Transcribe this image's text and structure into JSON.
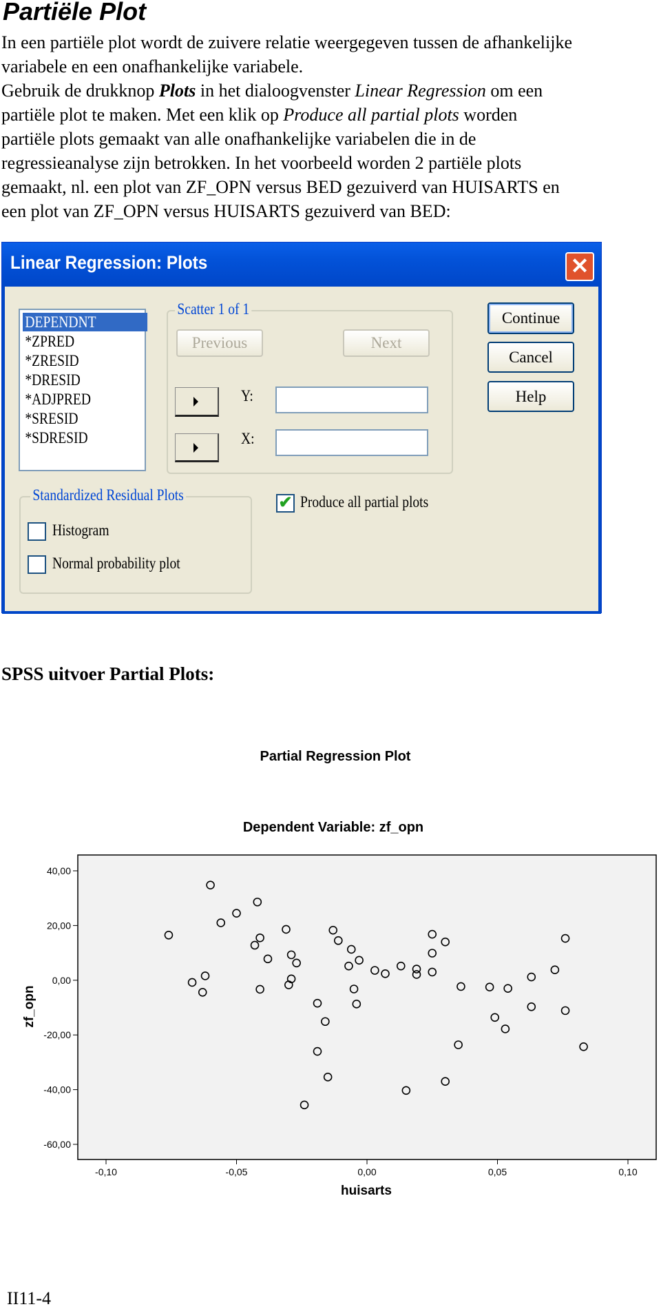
{
  "title": "Partiële Plot",
  "paragraph": [
    [
      {
        "t": "In een partiële plot wordt de zuivere relatie weergegeven tussen de afhankelijke",
        "s": ""
      }
    ],
    [
      {
        "t": "variabele en een onafhankelijke variabele.",
        "s": ""
      }
    ],
    [
      {
        "t": "Gebruik de drukknop ",
        "s": ""
      },
      {
        "t": "Plots",
        "s": "b i"
      },
      {
        "t": " in het dialoogvenster ",
        "s": ""
      },
      {
        "t": "Linear Regression",
        "s": "i"
      },
      {
        "t": " om een",
        "s": ""
      }
    ],
    [
      {
        "t": "partiële plot te maken. Met een klik op ",
        "s": ""
      },
      {
        "t": "Produce all partial plots",
        "s": "i"
      },
      {
        "t": " worden",
        "s": ""
      }
    ],
    [
      {
        "t": "partiële plots gemaakt van alle onafhankelijke variabelen die in de",
        "s": ""
      }
    ],
    [
      {
        "t": "regressieanalyse zijn betrokken. In het voorbeeld worden 2 partiële plots",
        "s": ""
      }
    ],
    [
      {
        "t": "gemaakt, nl. een plot van ZF_OPN versus BED gezuiverd van HUISARTS en",
        "s": ""
      }
    ],
    [
      {
        "t": "een plot van ZF_OPN versus HUISARTS gezuiverd van BED:",
        "s": ""
      }
    ]
  ],
  "dialog": {
    "title": "Linear Regression: Plots",
    "close_icon": "close-x-icon",
    "variables": [
      "DEPENDNT",
      "*ZPRED",
      "*ZRESID",
      "*DRESID",
      "*ADJPRED",
      "*SRESID",
      "*SDRESID"
    ],
    "selected_variable": "DEPENDNT",
    "scatter_group": "Scatter 1 of 1",
    "previous": "Previous",
    "next": "Next",
    "y_label": "Y:",
    "x_label": "X:",
    "y_value": "",
    "x_value": "",
    "continue": "Continue",
    "cancel": "Cancel",
    "help": "Help",
    "std_group": "Standardized Residual Plots",
    "histogram": {
      "label": "Histogram",
      "checked": false
    },
    "normal": {
      "label": "Normal probability plot",
      "checked": false
    },
    "partial": {
      "label": "Produce all partial plots",
      "checked": true
    }
  },
  "spss_heading": "SPSS uitvoer Partial Plots:",
  "chart_data": {
    "type": "scatter",
    "title": "Partial Regression Plot",
    "subtitle": "Dependent Variable: zf_opn",
    "xlabel": "huisarts",
    "ylabel": "zf_opn",
    "xlim": [
      -0.11,
      0.11
    ],
    "ylim": [
      -66,
      46
    ],
    "xticks": [
      -0.1,
      -0.05,
      0.0,
      0.05,
      0.1
    ],
    "xtick_labels": [
      "-0,10",
      "-0,05",
      "0,00",
      "0,05",
      "0,10"
    ],
    "yticks": [
      40,
      20,
      0,
      -20,
      -40,
      -60
    ],
    "ytick_labels": [
      "40,00",
      "20,00",
      "0,00",
      "-20,00",
      "-40,00",
      "-60,00"
    ],
    "grid": false,
    "background": "#f2f2f2",
    "marker": "open-circle",
    "points": [
      [
        -0.076,
        16.5
      ],
      [
        -0.06,
        34.8
      ],
      [
        -0.05,
        24.5
      ],
      [
        -0.056,
        21.0
      ],
      [
        -0.042,
        28.6
      ],
      [
        -0.041,
        15.5
      ],
      [
        -0.043,
        12.8
      ],
      [
        -0.031,
        18.6
      ],
      [
        -0.029,
        9.3
      ],
      [
        -0.038,
        7.8
      ],
      [
        -0.027,
        6.3
      ],
      [
        -0.062,
        1.6
      ],
      [
        -0.067,
        -0.8
      ],
      [
        -0.063,
        -4.4
      ],
      [
        -0.041,
        -3.3
      ],
      [
        -0.029,
        0.5
      ],
      [
        -0.03,
        -1.7
      ],
      [
        -0.013,
        18.3
      ],
      [
        -0.011,
        14.5
      ],
      [
        -0.006,
        11.3
      ],
      [
        -0.003,
        7.3
      ],
      [
        -0.007,
        5.2
      ],
      [
        -0.005,
        -3.2
      ],
      [
        -0.004,
        -8.7
      ],
      [
        -0.019,
        -8.4
      ],
      [
        -0.016,
        -15.1
      ],
      [
        -0.019,
        -26.0
      ],
      [
        -0.015,
        -35.4
      ],
      [
        -0.024,
        -45.6
      ],
      [
        0.003,
        3.6
      ],
      [
        0.007,
        2.4
      ],
      [
        0.013,
        5.2
      ],
      [
        0.019,
        4.1
      ],
      [
        0.019,
        2.1
      ],
      [
        0.025,
        16.8
      ],
      [
        0.025,
        9.9
      ],
      [
        0.025,
        3.0
      ],
      [
        0.03,
        14.0
      ],
      [
        0.015,
        -40.3
      ],
      [
        0.03,
        -37.0
      ],
      [
        0.036,
        -2.3
      ],
      [
        0.035,
        -23.6
      ],
      [
        0.047,
        -2.5
      ],
      [
        0.054,
        -3.0
      ],
      [
        0.049,
        -13.6
      ],
      [
        0.053,
        -17.8
      ],
      [
        0.063,
        1.2
      ],
      [
        0.063,
        -9.7
      ],
      [
        0.072,
        3.8
      ],
      [
        0.076,
        15.3
      ],
      [
        0.076,
        -11.1
      ],
      [
        0.083,
        -24.3
      ]
    ]
  },
  "footer": "II11-4"
}
